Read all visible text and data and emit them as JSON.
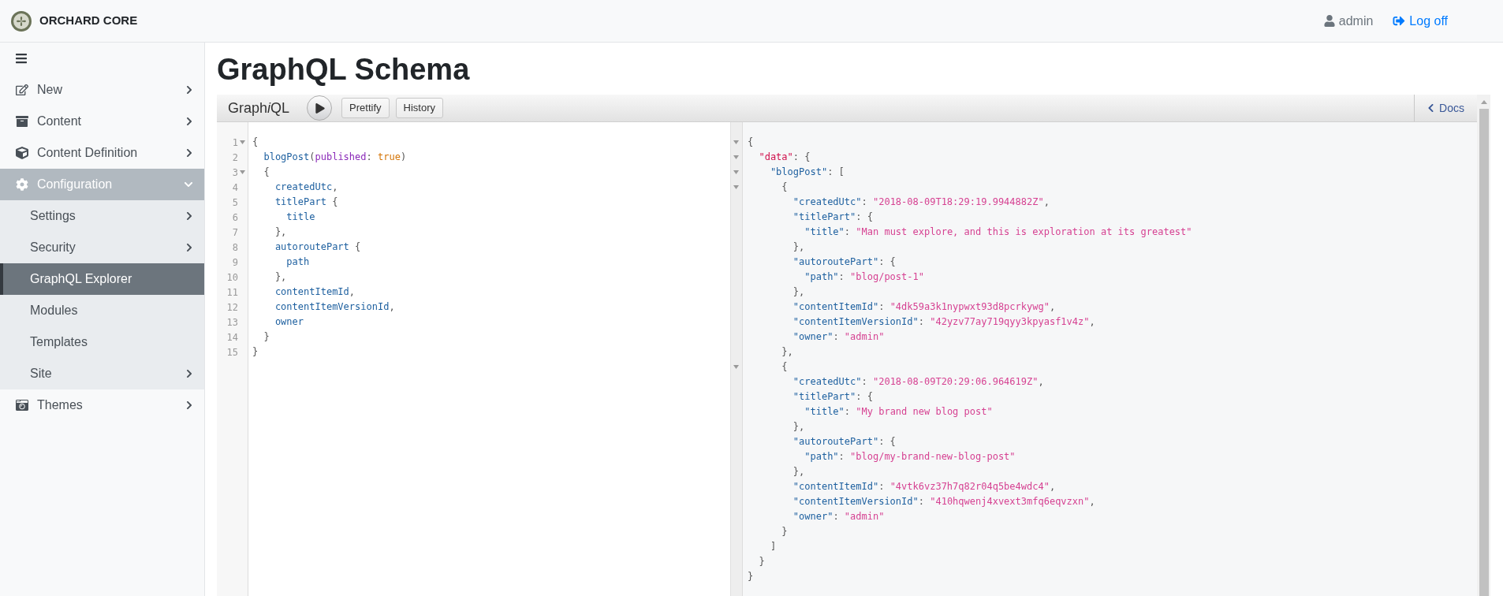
{
  "header": {
    "brand": "ORCHARD CORE",
    "user": "admin",
    "logoff": "Log off"
  },
  "sidebar": {
    "items": [
      {
        "label": "New",
        "has_children": true,
        "expanded": false,
        "selected": false
      },
      {
        "label": "Content",
        "has_children": true,
        "expanded": false,
        "selected": false
      },
      {
        "label": "Content Definition",
        "has_children": true,
        "expanded": false,
        "selected": false
      },
      {
        "label": "Configuration",
        "has_children": true,
        "expanded": true,
        "selected": false,
        "children": [
          {
            "label": "Settings",
            "has_children": true,
            "expanded": false,
            "selected": false
          },
          {
            "label": "Security",
            "has_children": true,
            "expanded": false,
            "selected": false
          },
          {
            "label": "GraphQL Explorer",
            "has_children": false,
            "expanded": false,
            "selected": true
          },
          {
            "label": "Modules",
            "has_children": false,
            "expanded": false,
            "selected": false
          },
          {
            "label": "Templates",
            "has_children": false,
            "expanded": false,
            "selected": false
          },
          {
            "label": "Site",
            "has_children": true,
            "expanded": false,
            "selected": false
          }
        ]
      },
      {
        "label": "Themes",
        "has_children": true,
        "expanded": false,
        "selected": false
      }
    ]
  },
  "page_title": "GraphQL Schema",
  "graphiql": {
    "logo": [
      {
        "text": "Graph",
        "italic": false
      },
      {
        "text": "i",
        "italic": true
      },
      {
        "text": "QL",
        "italic": false
      }
    ],
    "buttons": [
      "Prettify",
      "History"
    ],
    "docs": "Docs",
    "query": [
      {
        "number": "1",
        "fold": true,
        "tokens": [
          {
            "kind": "punct",
            "text": "{"
          }
        ]
      },
      {
        "number": "2",
        "fold": false,
        "tokens": [
          {
            "kind": "field",
            "text": "  blogPost"
          },
          {
            "kind": "punct",
            "text": "("
          },
          {
            "kind": "arg",
            "text": "published"
          },
          {
            "kind": "punct",
            "text": ": "
          },
          {
            "kind": "value",
            "text": "true"
          },
          {
            "kind": "punct",
            "text": ")"
          }
        ]
      },
      {
        "number": "3",
        "fold": true,
        "tokens": [
          {
            "kind": "punct",
            "text": "  {"
          }
        ]
      },
      {
        "number": "4",
        "fold": false,
        "tokens": [
          {
            "kind": "field",
            "text": "    createdUtc"
          },
          {
            "kind": "punct",
            "text": ","
          }
        ]
      },
      {
        "number": "5",
        "fold": false,
        "tokens": [
          {
            "kind": "field",
            "text": "    titlePart"
          },
          {
            "kind": "punct",
            "text": " {"
          }
        ]
      },
      {
        "number": "6",
        "fold": false,
        "tokens": [
          {
            "kind": "field",
            "text": "      title"
          }
        ]
      },
      {
        "number": "7",
        "fold": false,
        "tokens": [
          {
            "kind": "punct",
            "text": "    },"
          }
        ]
      },
      {
        "number": "8",
        "fold": false,
        "tokens": [
          {
            "kind": "field",
            "text": "    autoroutePart"
          },
          {
            "kind": "punct",
            "text": " {"
          }
        ]
      },
      {
        "number": "9",
        "fold": false,
        "tokens": [
          {
            "kind": "field",
            "text": "      path"
          }
        ]
      },
      {
        "number": "10",
        "fold": false,
        "tokens": [
          {
            "kind": "punct",
            "text": "    },"
          }
        ]
      },
      {
        "number": "11",
        "fold": false,
        "tokens": [
          {
            "kind": "field",
            "text": "    contentItemId"
          },
          {
            "kind": "punct",
            "text": ","
          }
        ]
      },
      {
        "number": "12",
        "fold": false,
        "tokens": [
          {
            "kind": "field",
            "text": "    contentItemVersionId"
          },
          {
            "kind": "punct",
            "text": ","
          }
        ]
      },
      {
        "number": "13",
        "fold": false,
        "tokens": [
          {
            "kind": "field",
            "text": "    owner"
          }
        ]
      },
      {
        "number": "14",
        "fold": false,
        "tokens": [
          {
            "kind": "punct",
            "text": "  }"
          }
        ]
      },
      {
        "number": "15",
        "fold": false,
        "tokens": [
          {
            "kind": "punct",
            "text": "}"
          }
        ]
      }
    ],
    "result": [
      {
        "fold": true,
        "tokens": [
          {
            "kind": "punct",
            "text": "{"
          }
        ]
      },
      {
        "fold": true,
        "tokens": [
          {
            "kind": "root_key",
            "text": "  \"data\""
          },
          {
            "kind": "punct",
            "text": ": {"
          }
        ]
      },
      {
        "fold": true,
        "tokens": [
          {
            "kind": "key",
            "text": "    \"blogPost\""
          },
          {
            "kind": "punct",
            "text": ": ["
          }
        ]
      },
      {
        "fold": true,
        "tokens": [
          {
            "kind": "punct",
            "text": "      {"
          }
        ]
      },
      {
        "fold": false,
        "tokens": [
          {
            "kind": "key",
            "text": "        \"createdUtc\""
          },
          {
            "kind": "punct",
            "text": ": "
          },
          {
            "kind": "string",
            "text": "\"2018-08-09T18:29:19.9944882Z\""
          },
          {
            "kind": "punct",
            "text": ","
          }
        ]
      },
      {
        "fold": false,
        "tokens": [
          {
            "kind": "key",
            "text": "        \"titlePart\""
          },
          {
            "kind": "punct",
            "text": ": {"
          }
        ]
      },
      {
        "fold": false,
        "tokens": [
          {
            "kind": "key",
            "text": "          \"title\""
          },
          {
            "kind": "punct",
            "text": ": "
          },
          {
            "kind": "string",
            "text": "\"Man must explore, and this is exploration at its greatest\""
          }
        ]
      },
      {
        "fold": false,
        "tokens": [
          {
            "kind": "punct",
            "text": "        },"
          }
        ]
      },
      {
        "fold": false,
        "tokens": [
          {
            "kind": "key",
            "text": "        \"autoroutePart\""
          },
          {
            "kind": "punct",
            "text": ": {"
          }
        ]
      },
      {
        "fold": false,
        "tokens": [
          {
            "kind": "key",
            "text": "          \"path\""
          },
          {
            "kind": "punct",
            "text": ": "
          },
          {
            "kind": "string",
            "text": "\"blog/post-1\""
          }
        ]
      },
      {
        "fold": false,
        "tokens": [
          {
            "kind": "punct",
            "text": "        },"
          }
        ]
      },
      {
        "fold": false,
        "tokens": [
          {
            "kind": "key",
            "text": "        \"contentItemId\""
          },
          {
            "kind": "punct",
            "text": ": "
          },
          {
            "kind": "string",
            "text": "\"4dk59a3k1nypwxt93d8pcrkywg\""
          },
          {
            "kind": "punct",
            "text": ","
          }
        ]
      },
      {
        "fold": false,
        "tokens": [
          {
            "kind": "key",
            "text": "        \"contentItemVersionId\""
          },
          {
            "kind": "punct",
            "text": ": "
          },
          {
            "kind": "string",
            "text": "\"42yzv77ay719qyy3kpyasf1v4z\""
          },
          {
            "kind": "punct",
            "text": ","
          }
        ]
      },
      {
        "fold": false,
        "tokens": [
          {
            "kind": "key",
            "text": "        \"owner\""
          },
          {
            "kind": "punct",
            "text": ": "
          },
          {
            "kind": "string",
            "text": "\"admin\""
          }
        ]
      },
      {
        "fold": false,
        "tokens": [
          {
            "kind": "punct",
            "text": "      },"
          }
        ]
      },
      {
        "fold": true,
        "tokens": [
          {
            "kind": "punct",
            "text": "      {"
          }
        ]
      },
      {
        "fold": false,
        "tokens": [
          {
            "kind": "key",
            "text": "        \"createdUtc\""
          },
          {
            "kind": "punct",
            "text": ": "
          },
          {
            "kind": "string",
            "text": "\"2018-08-09T20:29:06.964619Z\""
          },
          {
            "kind": "punct",
            "text": ","
          }
        ]
      },
      {
        "fold": false,
        "tokens": [
          {
            "kind": "key",
            "text": "        \"titlePart\""
          },
          {
            "kind": "punct",
            "text": ": {"
          }
        ]
      },
      {
        "fold": false,
        "tokens": [
          {
            "kind": "key",
            "text": "          \"title\""
          },
          {
            "kind": "punct",
            "text": ": "
          },
          {
            "kind": "string",
            "text": "\"My brand new blog post\""
          }
        ]
      },
      {
        "fold": false,
        "tokens": [
          {
            "kind": "punct",
            "text": "        },"
          }
        ]
      },
      {
        "fold": false,
        "tokens": [
          {
            "kind": "key",
            "text": "        \"autoroutePart\""
          },
          {
            "kind": "punct",
            "text": ": {"
          }
        ]
      },
      {
        "fold": false,
        "tokens": [
          {
            "kind": "key",
            "text": "          \"path\""
          },
          {
            "kind": "punct",
            "text": ": "
          },
          {
            "kind": "string",
            "text": "\"blog/my-brand-new-blog-post\""
          }
        ]
      },
      {
        "fold": false,
        "tokens": [
          {
            "kind": "punct",
            "text": "        },"
          }
        ]
      },
      {
        "fold": false,
        "tokens": [
          {
            "kind": "key",
            "text": "        \"contentItemId\""
          },
          {
            "kind": "punct",
            "text": ": "
          },
          {
            "kind": "string",
            "text": "\"4vtk6vz37h7q82r04q5be4wdc4\""
          },
          {
            "kind": "punct",
            "text": ","
          }
        ]
      },
      {
        "fold": false,
        "tokens": [
          {
            "kind": "key",
            "text": "        \"contentItemVersionId\""
          },
          {
            "kind": "punct",
            "text": ": "
          },
          {
            "kind": "string",
            "text": "\"410hqwenj4xvext3mfq6eqvzxn\""
          },
          {
            "kind": "punct",
            "text": ","
          }
        ]
      },
      {
        "fold": false,
        "tokens": [
          {
            "kind": "key",
            "text": "        \"owner\""
          },
          {
            "kind": "punct",
            "text": ": "
          },
          {
            "kind": "string",
            "text": "\"admin\""
          }
        ]
      },
      {
        "fold": false,
        "tokens": [
          {
            "kind": "punct",
            "text": "      }"
          }
        ]
      },
      {
        "fold": false,
        "tokens": [
          {
            "kind": "punct",
            "text": "    ]"
          }
        ]
      },
      {
        "fold": false,
        "tokens": [
          {
            "kind": "punct",
            "text": "  }"
          }
        ]
      },
      {
        "fold": false,
        "tokens": [
          {
            "kind": "punct",
            "text": "}"
          }
        ]
      }
    ]
  }
}
